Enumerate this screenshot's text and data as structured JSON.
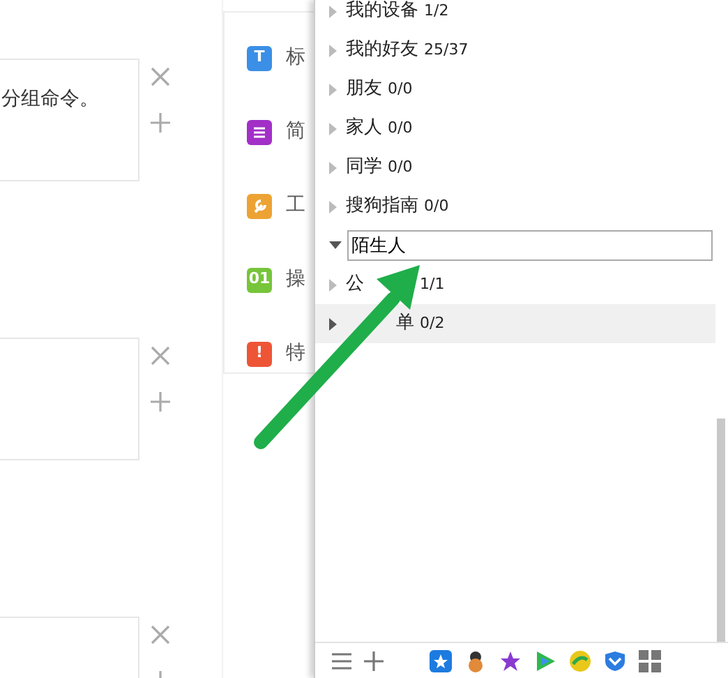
{
  "editor_blocks": [
    {
      "kind": "text",
      "text": "分组命令。"
    },
    {
      "kind": "empty"
    },
    {
      "kind": "empty"
    }
  ],
  "module_menu": [
    {
      "label": "标",
      "icon_text": "T",
      "color": "#3b8fe6"
    },
    {
      "label": "简",
      "color": "#a22fc6"
    },
    {
      "label": "工",
      "color": "#eda333"
    },
    {
      "label": "操",
      "icon_text": "01",
      "color": "#76c53a"
    },
    {
      "label": "特",
      "icon_text": "!",
      "color": "#ee5537"
    }
  ],
  "contact_groups": [
    {
      "kind": "group",
      "name": "我的设备",
      "count": "1/2",
      "expanded": false,
      "highlighted": false
    },
    {
      "kind": "group",
      "name": "我的好友",
      "count": "25/37",
      "expanded": false,
      "highlighted": false
    },
    {
      "kind": "group",
      "name": "朋友",
      "count": "0/0",
      "expanded": false,
      "highlighted": false
    },
    {
      "kind": "group",
      "name": "家人",
      "count": "0/0",
      "expanded": false,
      "highlighted": false
    },
    {
      "kind": "group",
      "name": "同学",
      "count": "0/0",
      "expanded": false,
      "highlighted": false
    },
    {
      "kind": "group",
      "name": "搜狗指南",
      "count": "0/0",
      "expanded": false,
      "highlighted": false
    },
    {
      "kind": "rename",
      "value": "陌生人",
      "expanded": true,
      "highlighted": false
    },
    {
      "kind": "tailhidden",
      "name": "公",
      "count": "1/1",
      "expanded": false,
      "highlighted": false
    },
    {
      "kind": "headhidden",
      "name": "单",
      "count": "0/2",
      "expanded": false,
      "highlighted": true
    }
  ]
}
